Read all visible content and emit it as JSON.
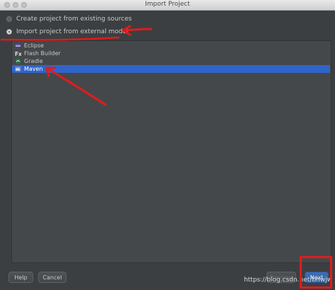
{
  "window": {
    "title": "Import Project"
  },
  "options": [
    {
      "label": "Create project from existing sources",
      "selected": false
    },
    {
      "label": "Import project from external model",
      "selected": true
    }
  ],
  "models": [
    {
      "label": "Eclipse",
      "icon": "eclipse-icon",
      "selected": false
    },
    {
      "label": "Flash Builder",
      "icon": "flash-builder-icon",
      "selected": false
    },
    {
      "label": "Gradle",
      "icon": "gradle-icon",
      "selected": false
    },
    {
      "label": "Maven",
      "icon": "maven-icon",
      "selected": true
    }
  ],
  "buttons": {
    "help": "Help",
    "cancel": "Cancel",
    "previous": "Previous",
    "next": "Next"
  },
  "watermark": "https://blog.csdn.net/bhwjw",
  "colors": {
    "selection": "#2f65ca",
    "annotation": "#e21b1b",
    "background": "#3c3f41"
  }
}
